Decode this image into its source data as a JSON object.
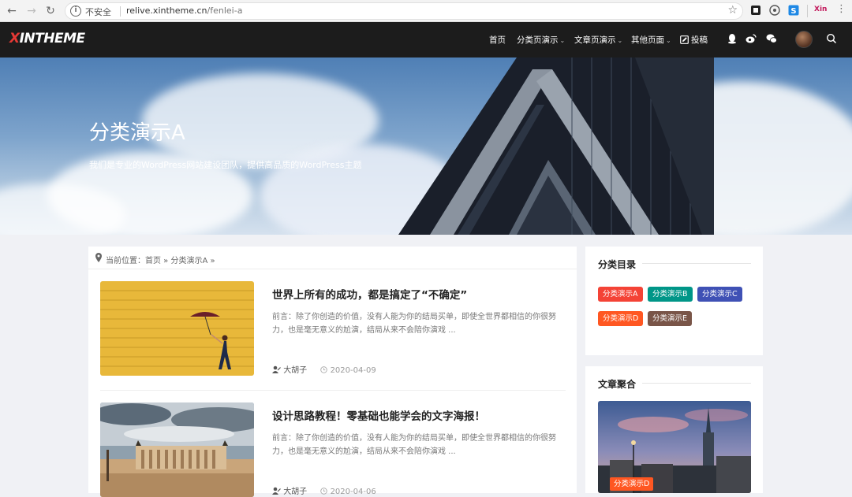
{
  "browser": {
    "insecure_label": "不安全",
    "url_host": "relive.xintheme.cn",
    "url_path": "/fenlei-a",
    "ext_label": "Xin"
  },
  "site": {
    "logo_x": "X",
    "logo_rest": "INTHEME",
    "menu": [
      {
        "label": "首页"
      },
      {
        "label": "分类页演示"
      },
      {
        "label": "文章页演示"
      },
      {
        "label": "其他页面"
      },
      {
        "label": "投稿"
      }
    ]
  },
  "banner": {
    "title": "分类演示A",
    "subtitle": "我们是专业的WordPress网站建设团队，提供高品质的WordPress主题"
  },
  "breadcrumb": {
    "text": "当前位置：首页 » 分类演示A »"
  },
  "posts": [
    {
      "title": "世界上所有的成功，都是搞定了“不确定”",
      "excerpt": "前言：除了你创造的价值，没有人能为你的结局买单，即使全世界都相信的你很努力，也是毫无意义的尬演，结局从来不会陪你演戏 ...",
      "author": "大胡子",
      "date": "2020-04-09"
    },
    {
      "title": "设计思路教程！零基础也能学会的文字海报！",
      "excerpt": "前言：除了你创造的价值，没有人能为你的结局买单，即使全世界都相信的你很努力，也是毫无意义的尬演，结局从来不会陪你演戏 ...",
      "author": "大胡子",
      "date": "2020-04-06"
    }
  ],
  "sidebar": {
    "categories_title": "分类目录",
    "tags": [
      {
        "label": "分类演示A",
        "color": "#f44336"
      },
      {
        "label": "分类演示B",
        "color": "#009688"
      },
      {
        "label": "分类演示C",
        "color": "#3f51b5"
      },
      {
        "label": "分类演示D",
        "color": "#ff5722"
      },
      {
        "label": "分类演示E",
        "color": "#795548"
      }
    ],
    "feature_title": "文章聚合",
    "feature_badge": "分类演示D"
  }
}
